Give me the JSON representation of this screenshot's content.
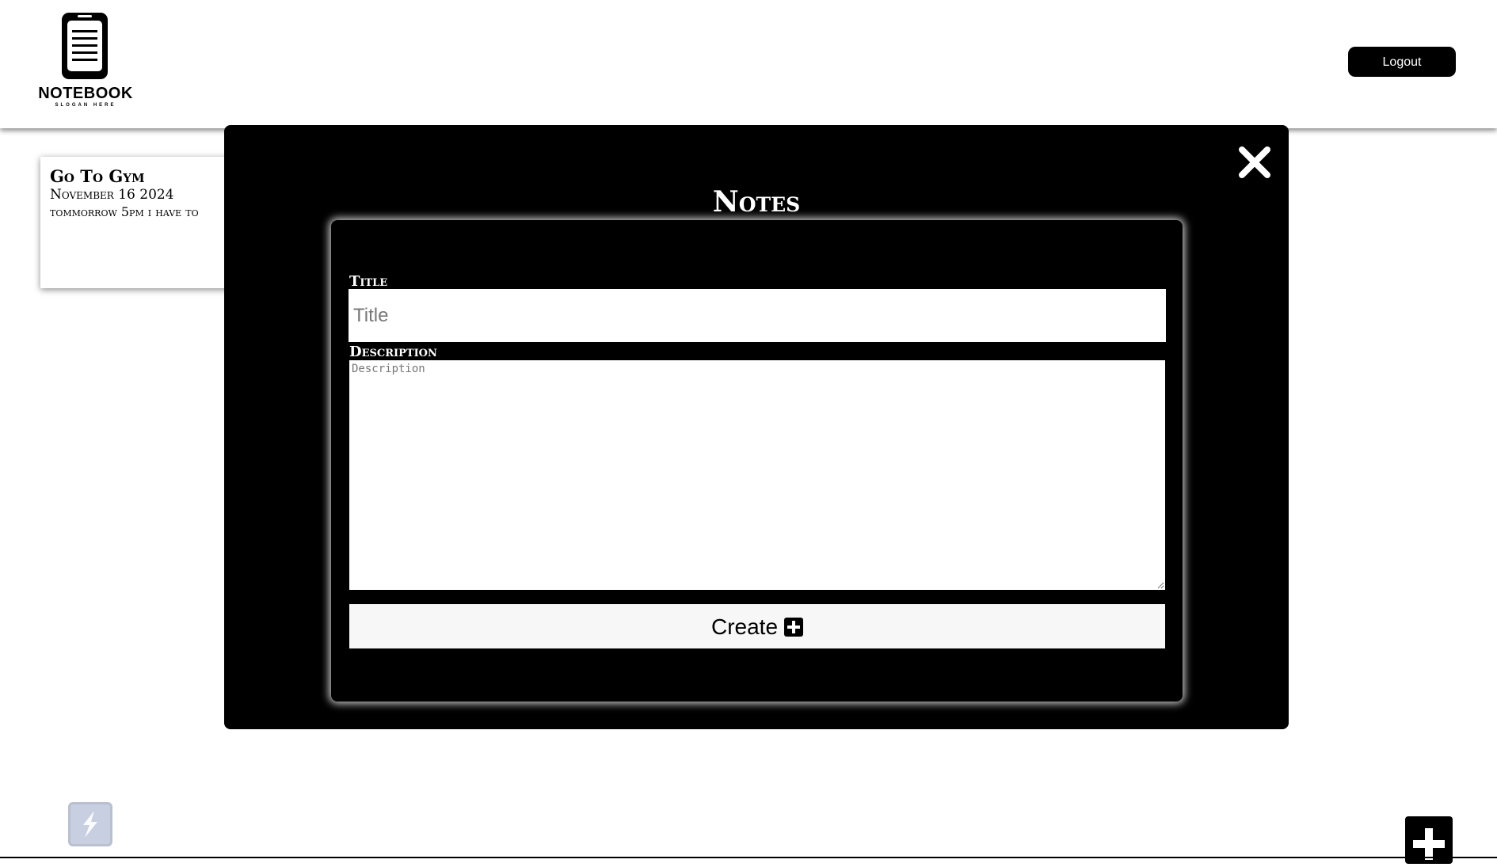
{
  "header": {
    "logo_title": "NOTEBOOK",
    "logo_slogan": "SLOGAN HERE",
    "logout_label": "Logout"
  },
  "notes": [
    {
      "title": "Go To Gym",
      "date": "November 16 2024",
      "body": "tommorrow 5pm i have to"
    }
  ],
  "modal": {
    "title": "Notes",
    "close_icon": "close-icon",
    "title_label": "Title",
    "title_placeholder": "Title",
    "title_value": "",
    "description_label": "Description",
    "description_placeholder": "Description",
    "description_value": "",
    "create_label": "Create",
    "create_icon": "plus-square-icon"
  },
  "footer": {
    "left_icon": "bolt-icon",
    "fab_icon": "plus-icon"
  },
  "colors": {
    "primary": "#000000",
    "background": "#ffffff",
    "button_light": "#f7f7f7",
    "bolt_bg": "#c7cfe0"
  }
}
